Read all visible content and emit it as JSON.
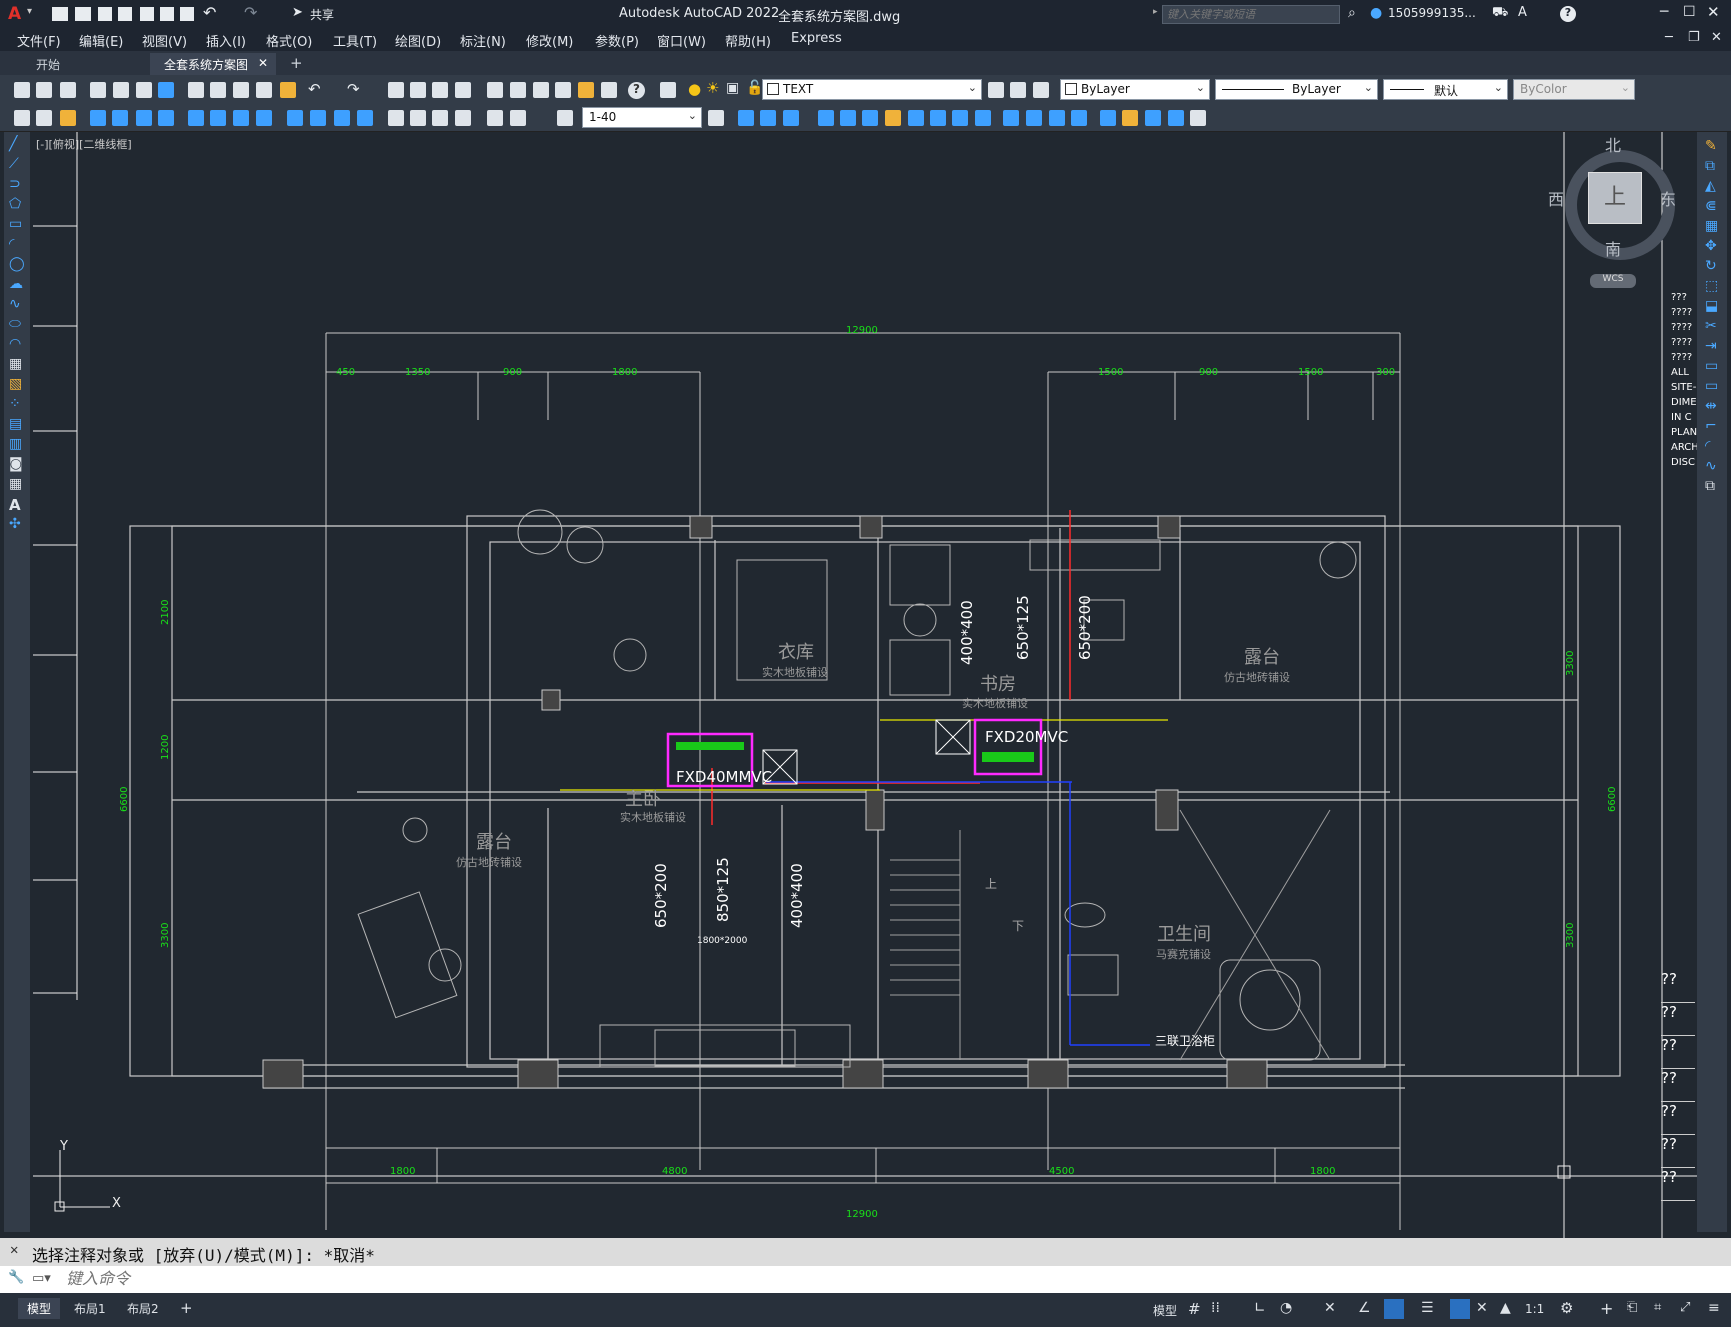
{
  "app": {
    "title": "Autodesk AutoCAD 2022",
    "document": "全套系统方案图.dwg",
    "share_label": "共享",
    "search_placeholder": "键入关键字或短语",
    "user": "1505999135...",
    "help": "?"
  },
  "menu": [
    "文件(F)",
    "编辑(E)",
    "视图(V)",
    "插入(I)",
    "格式(O)",
    "工具(T)",
    "绘图(D)",
    "标注(N)",
    "修改(M)",
    "参数(P)",
    "窗口(W)",
    "帮助(H)",
    "Express"
  ],
  "tabs": [
    {
      "label": "开始",
      "active": false
    },
    {
      "label": "全套系统方案图*",
      "active": true
    }
  ],
  "toolbar": {
    "layer": "TEXT",
    "color": "ByLayer",
    "linetype": "ByLayer",
    "lineweight": "默认",
    "plotstyle": "ByColor",
    "scale": "1-40"
  },
  "viewport_label": "[-][俯视][二维线框]",
  "viewcube": {
    "north": "北",
    "south": "南",
    "east": "东",
    "west": "西",
    "top": "上",
    "wcs": "WCS"
  },
  "drawing": {
    "dims_top_total": "12900",
    "dims_top": [
      "450",
      "1350",
      "900",
      "1800",
      "1500",
      "900",
      "1500",
      "300"
    ],
    "dims_bottom_total": "12900",
    "dims_bottom": [
      "1800",
      "4800",
      "4500",
      "1800"
    ],
    "dims_left": [
      "2100",
      "1200",
      "3300"
    ],
    "dims_left_total": "6600",
    "dims_right": [
      "3300",
      "3300"
    ],
    "dims_right_total": "6600",
    "rooms": [
      {
        "name": "衣库",
        "floor": "实木地板铺设"
      },
      {
        "name": "书房",
        "floor": "实木地板铺设"
      },
      {
        "name": "露台",
        "floor": "仿古地砖铺设"
      },
      {
        "name": "主卧",
        "floor": "实木地板铺设"
      },
      {
        "name": "露台",
        "floor": "仿古地砖铺设"
      },
      {
        "name": "卫生间",
        "floor": "马赛克铺设"
      }
    ],
    "equipment": [
      "FXD40MMVC",
      "FXD20MVC"
    ],
    "vents": [
      "400*400",
      "650*125",
      "650*200",
      "650*200",
      "850*125",
      "400*400"
    ],
    "stair_labels": [
      "上",
      "下"
    ],
    "bed_label": "1800*2000",
    "bath_label": "三联卫浴柜"
  },
  "right_layers": [
    "???",
    "????",
    "????",
    "????",
    "????",
    "ALL",
    "SITE-",
    "DIME",
    "IN C",
    "PLAN",
    "ARCH",
    "DISC"
  ],
  "right_qs": [
    "??",
    "??",
    "??",
    "??",
    "??",
    "??",
    "??"
  ],
  "command": {
    "history": "选择注释对象或 [放弃(U)/模式(M)]: *取消*",
    "placeholder": "键入命令"
  },
  "layout_tabs": [
    {
      "label": "模型",
      "active": true
    },
    {
      "label": "布局1",
      "active": false
    },
    {
      "label": "布局2",
      "active": false
    }
  ],
  "status": {
    "model": "模型",
    "scale": "1:1"
  }
}
